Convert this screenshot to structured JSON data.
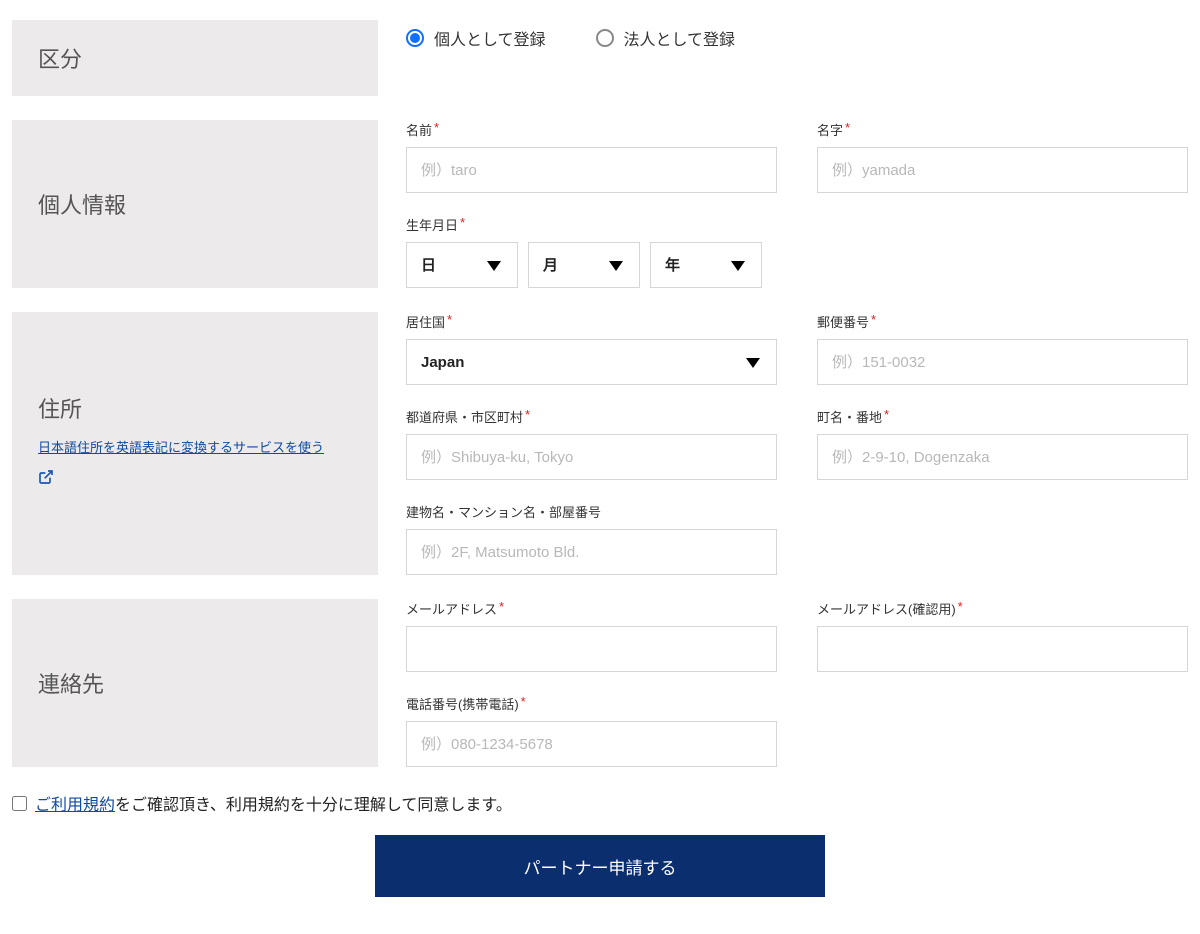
{
  "sections": {
    "category": {
      "title": "区分",
      "radio_individual": "個人として登録",
      "radio_corporate": "法人として登録"
    },
    "personal": {
      "title": "個人情報",
      "firstname_label": "名前",
      "firstname_placeholder": "例）taro",
      "lastname_label": "名字",
      "lastname_placeholder": "例）yamada",
      "dob_label": "生年月日",
      "day": "日",
      "month": "月",
      "year": "年"
    },
    "address": {
      "title": "住所",
      "helper_link": "日本語住所を英語表記に変換するサービスを使う",
      "country_label": "居住国",
      "country_value": "Japan",
      "postal_label": "郵便番号",
      "postal_placeholder": "例）151-0032",
      "prefecture_label": "都道府県・市区町村",
      "prefecture_placeholder": "例）Shibuya-ku, Tokyo",
      "street_label": "町名・番地",
      "street_placeholder": "例）2-9-10, Dogenzaka",
      "building_label": "建物名・マンション名・部屋番号",
      "building_placeholder": "例）2F, Matsumoto Bld."
    },
    "contact": {
      "title": "連絡先",
      "email_label": "メールアドレス",
      "email_confirm_label": "メールアドレス(確認用)",
      "phone_label": "電話番号(携帯電話)",
      "phone_placeholder": "例）080-1234-5678"
    }
  },
  "terms": {
    "link_text": "ご利用規約",
    "rest_text": "をご確認頂き、利用規約を十分に理解して同意します。"
  },
  "submit_label": "パートナー申請する"
}
